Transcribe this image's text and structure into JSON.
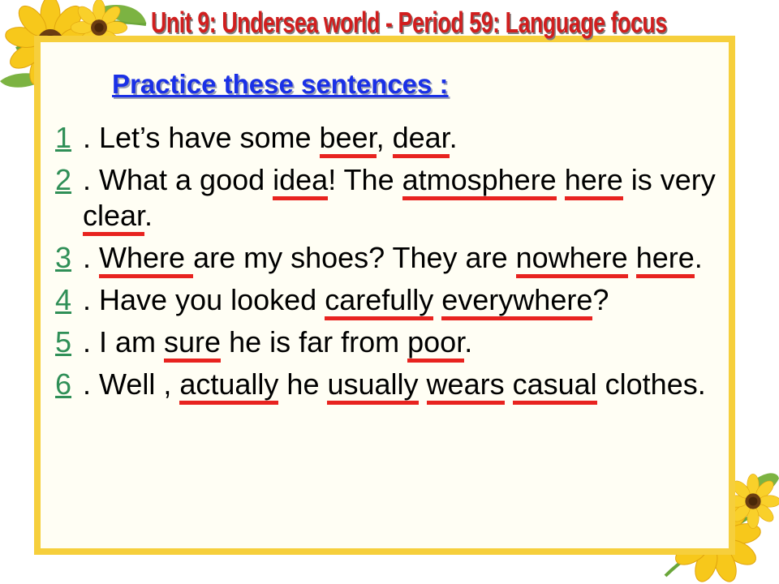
{
  "header": {
    "unit_title": "Unit 9: Undersea world - Period 59: Language focus",
    "practice_heading": "Practice these sentences :"
  },
  "sentences": [
    {
      "number": "1",
      "parts": [
        ". Let’s have some ",
        "beer",
        ", ",
        "dear",
        "."
      ]
    },
    {
      "number": "2",
      "parts": [
        ". What a good ",
        "idea",
        "! The ",
        "atmosphere",
        " ",
        "here",
        " is very ",
        "clear",
        "."
      ]
    },
    {
      "number": "3",
      "parts": [
        ". ",
        "Where ",
        "are my shoes? They are ",
        "nowhere",
        " ",
        "here",
        "."
      ]
    },
    {
      "number": "4",
      "parts": [
        ". Have you looked ",
        "carefully",
        " ",
        "everywhere",
        "?"
      ]
    },
    {
      "number": "5",
      "parts": [
        ". I am ",
        "sure",
        " he is far from ",
        "poor",
        "."
      ]
    },
    {
      "number": "6",
      "parts": [
        ". Well , ",
        "actually",
        " he ",
        "usually",
        " ",
        "wears",
        " ",
        "casual",
        " clothes."
      ]
    }
  ],
  "colors": {
    "frame": "#f6cf3c",
    "unit_title": "#d11e1e",
    "heading": "#1a30e6",
    "number": "#2f8f57",
    "underline_mark": "#e8231f"
  },
  "decorations": [
    "sunflower-icon"
  ]
}
